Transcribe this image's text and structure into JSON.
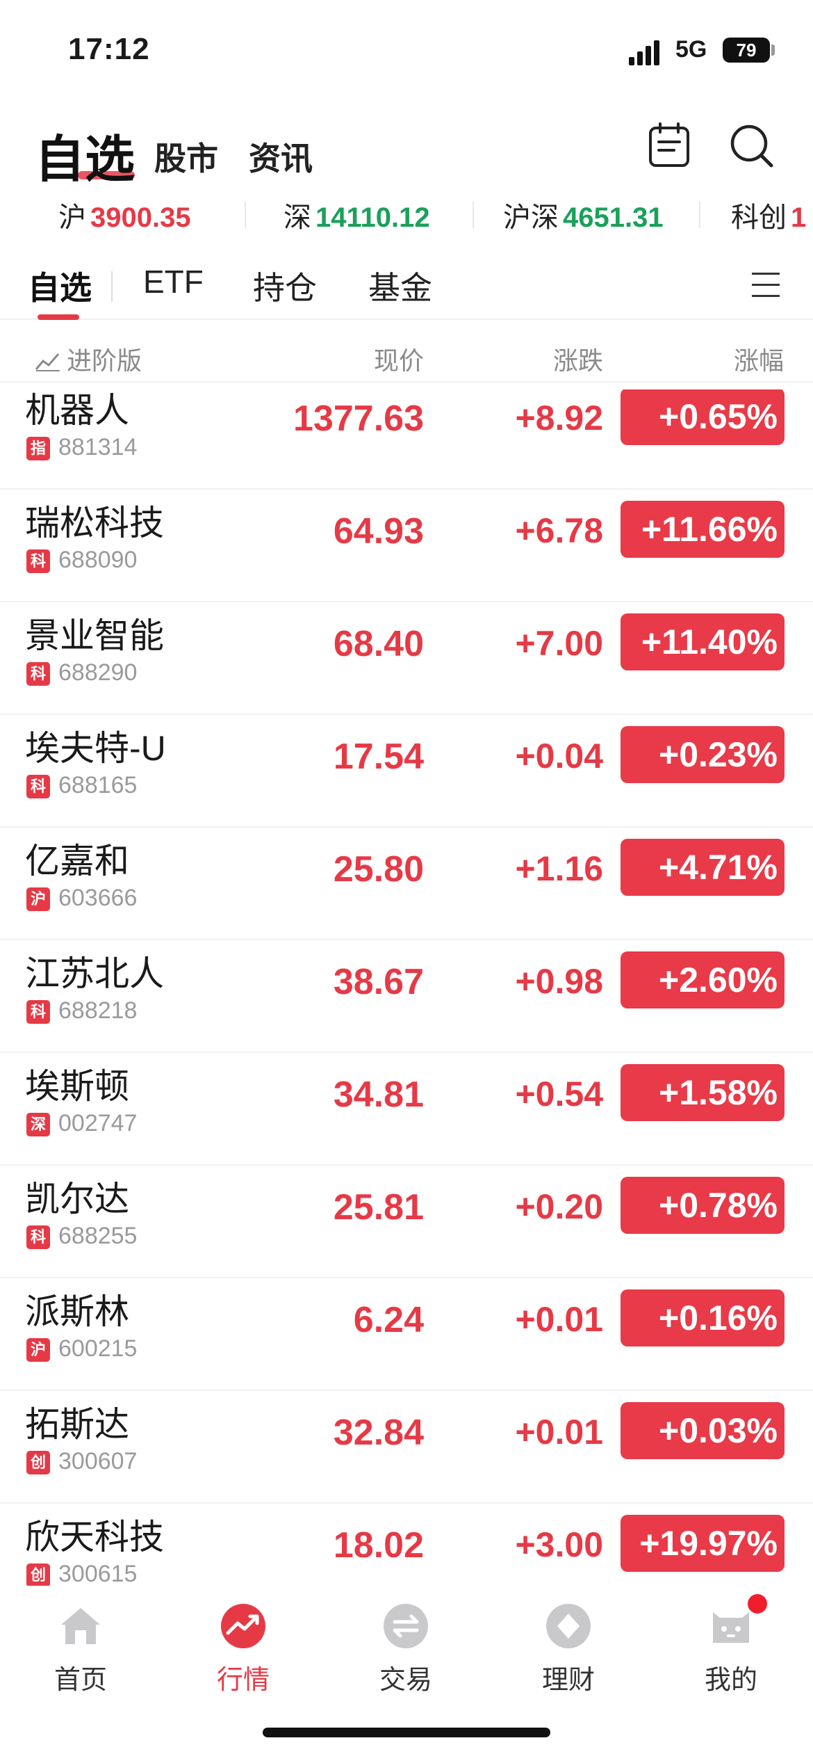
{
  "status_bar": {
    "time": "17:12",
    "network": "5G",
    "battery": "79"
  },
  "top_nav": {
    "active": "自选",
    "tabs": [
      "股市",
      "资讯"
    ]
  },
  "indices": [
    {
      "label": "沪",
      "value": "3900.35",
      "color": "#e63946"
    },
    {
      "label": "深",
      "value": "14110.12",
      "color": "#1aa05a"
    },
    {
      "label": "沪深",
      "value": "4651.31",
      "color": "#1aa05a"
    },
    {
      "label": "科创",
      "value": "1",
      "color": "#e63946"
    }
  ],
  "tabs": [
    "自选",
    "ETF",
    "持仓",
    "基金"
  ],
  "columns": {
    "advanced": "进阶版",
    "price": "现价",
    "change": "涨跌",
    "pct": "涨幅"
  },
  "stocks": [
    {
      "name": "机器人",
      "badge": "指",
      "code": "881314",
      "price": "1377.63",
      "change": "+8.92",
      "pct": "+0.65%"
    },
    {
      "name": "瑞松科技",
      "badge": "科",
      "code": "688090",
      "price": "64.93",
      "change": "+6.78",
      "pct": "+11.66%"
    },
    {
      "name": "景业智能",
      "badge": "科",
      "code": "688290",
      "price": "68.40",
      "change": "+7.00",
      "pct": "+11.40%"
    },
    {
      "name": "埃夫特-U",
      "badge": "科",
      "code": "688165",
      "price": "17.54",
      "change": "+0.04",
      "pct": "+0.23%"
    },
    {
      "name": "亿嘉和",
      "badge": "沪",
      "code": "603666",
      "price": "25.80",
      "change": "+1.16",
      "pct": "+4.71%"
    },
    {
      "name": "江苏北人",
      "badge": "科",
      "code": "688218",
      "price": "38.67",
      "change": "+0.98",
      "pct": "+2.60%"
    },
    {
      "name": "埃斯顿",
      "badge": "深",
      "code": "002747",
      "price": "34.81",
      "change": "+0.54",
      "pct": "+1.58%"
    },
    {
      "name": "凯尔达",
      "badge": "科",
      "code": "688255",
      "price": "25.81",
      "change": "+0.20",
      "pct": "+0.78%"
    },
    {
      "name": "派斯林",
      "badge": "沪",
      "code": "600215",
      "price": "6.24",
      "change": "+0.01",
      "pct": "+0.16%"
    },
    {
      "name": "拓斯达",
      "badge": "创",
      "code": "300607",
      "price": "32.84",
      "change": "+0.01",
      "pct": "+0.03%"
    },
    {
      "name": "欣天科技",
      "badge": "创",
      "code": "300615",
      "price": "18.02",
      "change": "+3.00",
      "pct": "+19.97%"
    }
  ],
  "bottom_nav": [
    {
      "label": "首页",
      "icon": "home-icon"
    },
    {
      "label": "行情",
      "icon": "market-trend-icon",
      "active": true
    },
    {
      "label": "交易",
      "icon": "exchange-icon"
    },
    {
      "label": "理财",
      "icon": "wealth-icon"
    },
    {
      "label": "我的",
      "icon": "profile-mascot-icon"
    }
  ]
}
